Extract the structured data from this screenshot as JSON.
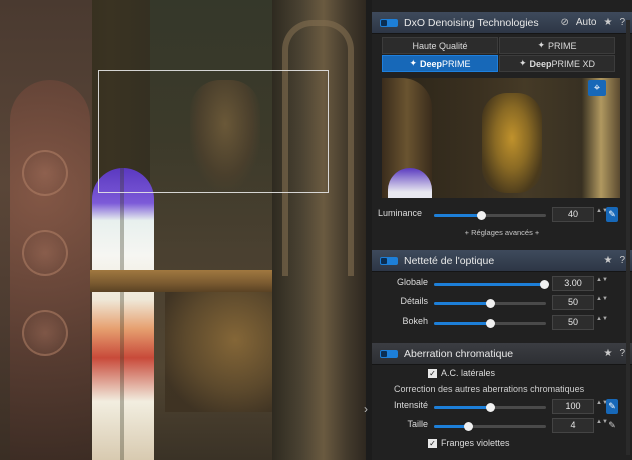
{
  "denoise": {
    "title": "DxO Denoising Technologies",
    "auto_label": "Auto",
    "tabs": {
      "haute": "Haute Qualité",
      "prime": "PRIME",
      "deepprime_bold": "Deep",
      "deepprime_rest": "PRIME",
      "deepprime_xd_bold": "Deep",
      "deepprime_xd_rest": "PRIME XD"
    },
    "luminance_label": "Luminance",
    "luminance_value": "40",
    "luminance_level": 0.42,
    "advanced_link": "+ Réglages avancés +"
  },
  "sharpness": {
    "title": "Netteté de l'optique",
    "rows": [
      {
        "label": "Globale",
        "value": "3.00",
        "level": 0.98
      },
      {
        "label": "Détails",
        "value": "50",
        "level": 0.5
      },
      {
        "label": "Bokeh",
        "value": "50",
        "level": 0.5
      }
    ]
  },
  "chromatic": {
    "title": "Aberration chromatique",
    "lateral_label": "A.C. latérales",
    "other_label": "Correction des autres aberrations chromatiques",
    "rows": [
      {
        "label": "Intensité",
        "value": "100",
        "level": 0.5
      },
      {
        "label": "Taille",
        "value": "4",
        "level": 0.3
      }
    ],
    "fringe_label": "Franges violettes"
  },
  "icons": {
    "star": "★",
    "help": "?",
    "eye_off": "⊘",
    "spin": "▲▼",
    "target": "⌖",
    "eyedropper": "✎",
    "collapse": "›",
    "check": "✓",
    "sparkle": "✦"
  },
  "colors": {
    "accent": "#1d7fd8",
    "tab_selected": "#1768b8",
    "panel_bg": "#212121"
  }
}
